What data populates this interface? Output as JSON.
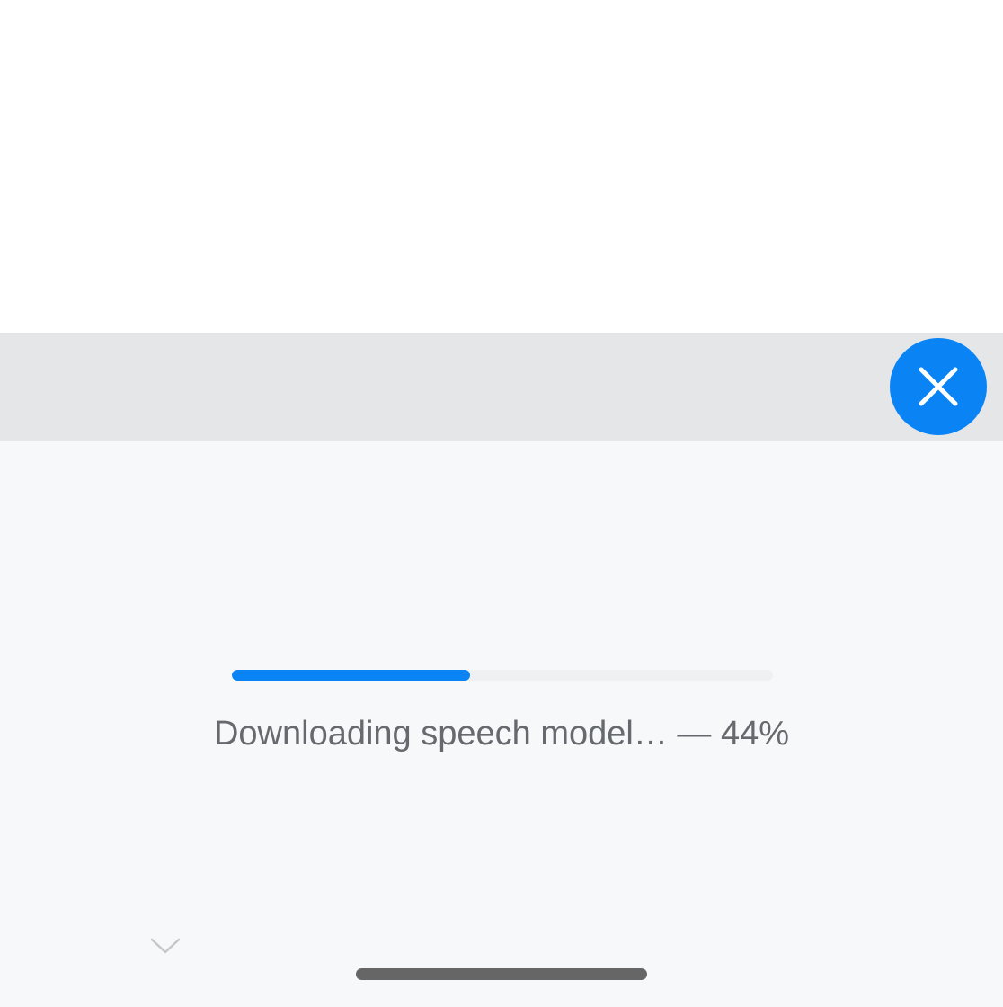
{
  "colors": {
    "accent": "#0a84f5",
    "toolbar_bg": "#e4e6e8",
    "panel_bg": "#f7f8fa",
    "text": "#666a6e",
    "home_indicator": "#666666"
  },
  "toolbar": {
    "close_icon": "close-icon"
  },
  "download": {
    "status_text": "Downloading speech model… — 44%",
    "progress_percent": 44
  },
  "panel": {
    "collapse_icon": "chevron-down-icon"
  }
}
